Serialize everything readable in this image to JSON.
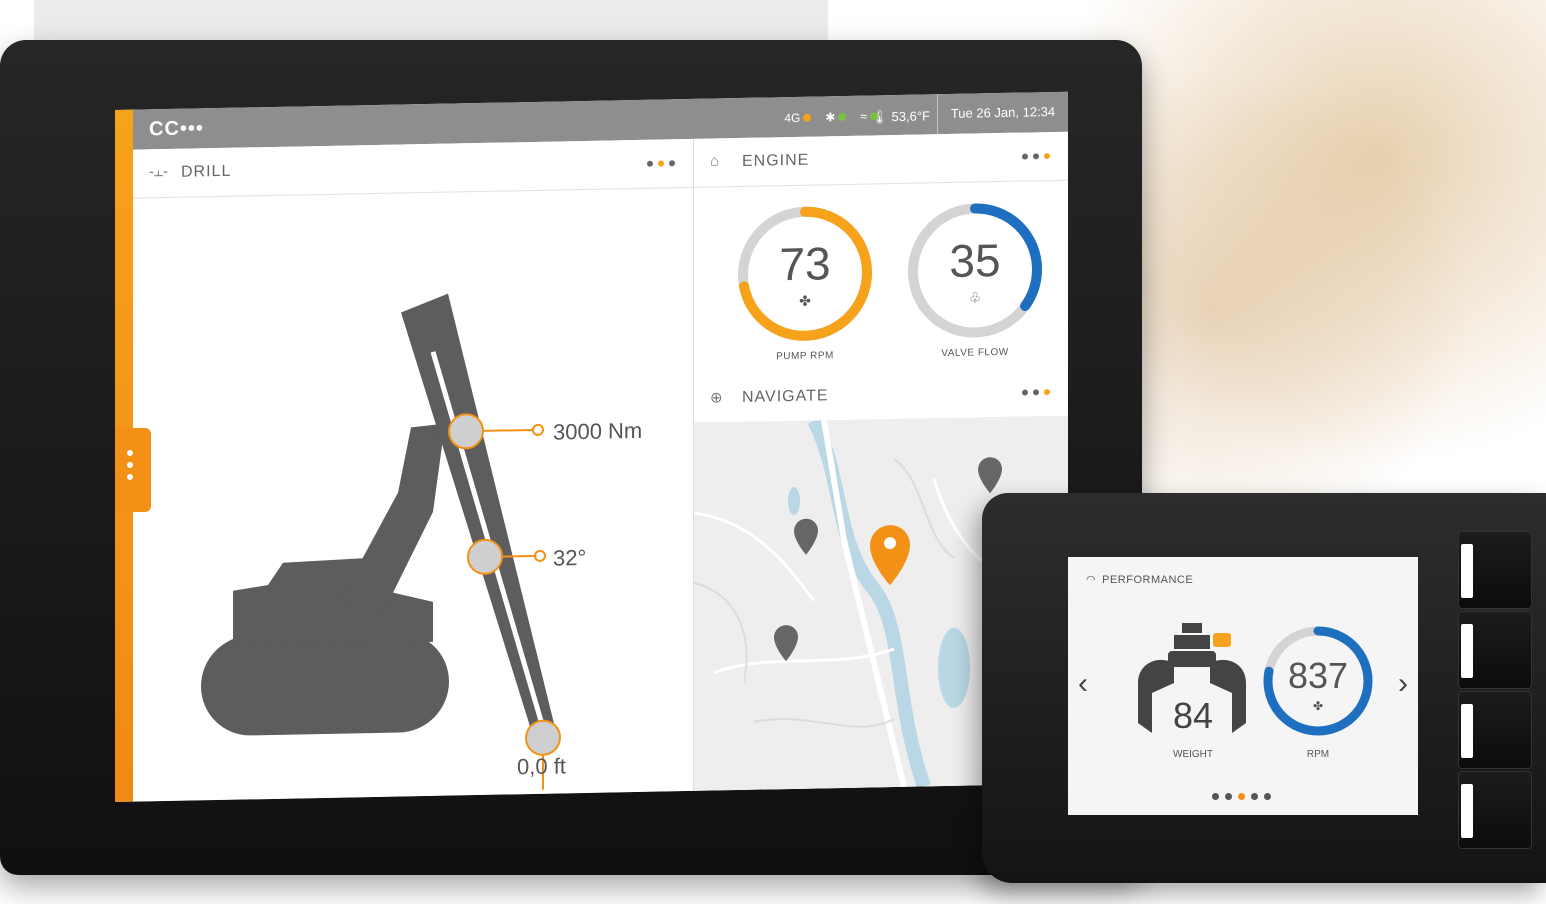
{
  "tablet": {
    "status_bar": {
      "logo": "CC•••",
      "network": "4G",
      "temperature": "53,6°F",
      "datetime": "Tue 26 Jan, 12:34"
    },
    "drill": {
      "title": "DRILL",
      "torque": "3000 Nm",
      "angle": "32°",
      "depth": "0,0 ft"
    },
    "engine": {
      "title": "ENGINE",
      "gauges": [
        {
          "value": "73",
          "label": "PUMP RPM",
          "fraction": 0.72,
          "color": "#f7a21b"
        },
        {
          "value": "35",
          "label": "VALVE FLOW",
          "fraction": 0.35,
          "color": "#1f6fc0"
        }
      ]
    },
    "navigate": {
      "title": "NAVIGATE"
    }
  },
  "device": {
    "title": "PERFORMANCE",
    "weight": {
      "value": "84",
      "label": "WEIGHT"
    },
    "rpm": {
      "value": "837",
      "label": "RPM",
      "fraction": 0.78,
      "color": "#1f6fc0"
    },
    "page_index": 3,
    "page_count": 5
  },
  "icons": {
    "drill": "drill-icon",
    "engine": "engine-icon",
    "navigate": "crosshair-icon",
    "fan": "fan-icon",
    "performance": "gauge-icon"
  }
}
